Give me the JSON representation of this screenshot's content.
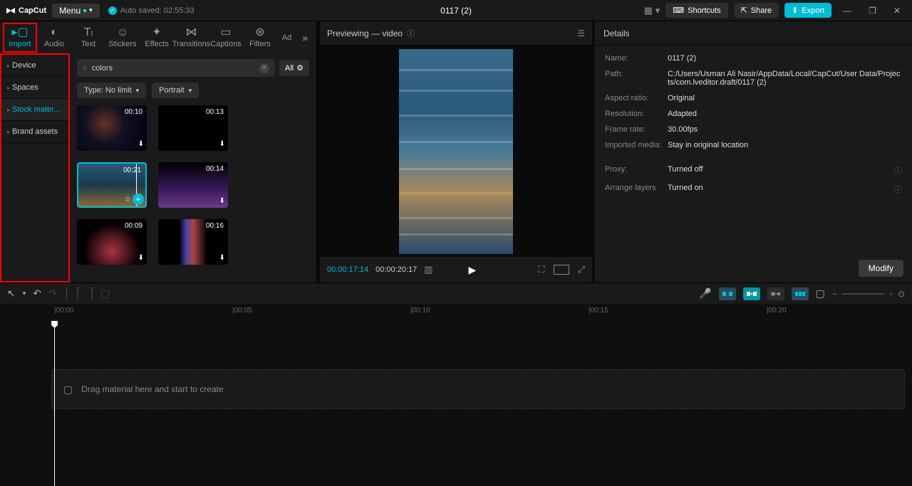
{
  "titlebar": {
    "logo": "CapCut",
    "menu": "Menu",
    "autosave": "Auto saved: 02:55:33",
    "project_title": "0117 (2)",
    "shortcuts": "Shortcuts",
    "share": "Share",
    "export": "Export"
  },
  "tool_tabs": [
    {
      "label": "Import",
      "icon": "▶"
    },
    {
      "label": "Audio",
      "icon": "◐"
    },
    {
      "label": "Text",
      "icon": "TI"
    },
    {
      "label": "Stickers",
      "icon": "☆"
    },
    {
      "label": "Effects",
      "icon": "✦"
    },
    {
      "label": "Transitions",
      "icon": "⊳⊲"
    },
    {
      "label": "Captions",
      "icon": "▭"
    },
    {
      "label": "Filters",
      "icon": "⊛"
    },
    {
      "label": "Ad",
      "icon": ""
    }
  ],
  "sidebar": [
    {
      "label": "Device"
    },
    {
      "label": "Spaces"
    },
    {
      "label": "Stock mater..."
    },
    {
      "label": "Brand assets"
    }
  ],
  "search": {
    "value": "colors"
  },
  "filter_all": "All",
  "filter_type": "Type: No limit",
  "filter_orient": "Portrait",
  "thumbs": [
    {
      "dur": "00:10"
    },
    {
      "dur": "00:13"
    },
    {
      "dur": "00:21"
    },
    {
      "dur": "00:14"
    },
    {
      "dur": "00:09"
    },
    {
      "dur": "00:16"
    }
  ],
  "preview": {
    "title": "Previewing — video",
    "tc_current": "00:00:17:14",
    "tc_total": "00:00:20:17"
  },
  "details": {
    "header": "Details",
    "name_label": "Name:",
    "name": "0117 (2)",
    "path_label": "Path:",
    "path": "C:/Users/Usman Ali Nasir/AppData/Local/CapCut/User Data/Projects/com.lveditor.draft/0117 (2)",
    "aspect_label": "Aspect ratio:",
    "aspect": "Original",
    "res_label": "Resolution:",
    "res": "Adapted",
    "fps_label": "Frame rate:",
    "fps": "30.00fps",
    "imported_label": "Imported media:",
    "imported": "Stay in original location",
    "proxy_label": "Proxy:",
    "proxy": "Turned off",
    "layers_label": "Arrange layers",
    "layers": "Turned on",
    "modify": "Modify"
  },
  "ruler": [
    "00:00",
    "00:05",
    "00:10",
    "00:15",
    "00:20"
  ],
  "dropzone": "Drag material here and start to create"
}
